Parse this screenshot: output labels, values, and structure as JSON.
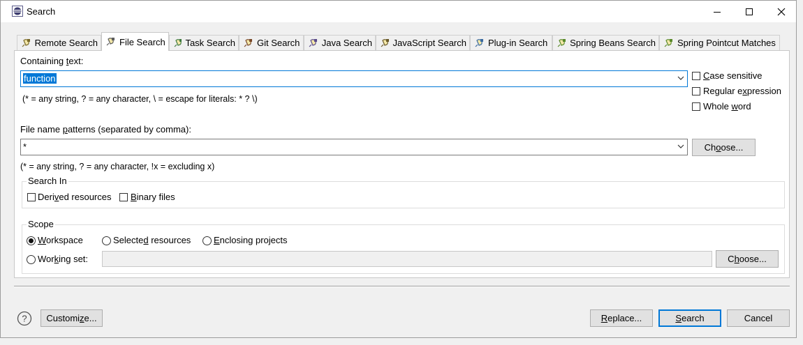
{
  "window": {
    "title": "Search"
  },
  "tabs": [
    {
      "label": "Remote Search",
      "active": false
    },
    {
      "label": "File Search",
      "active": true
    },
    {
      "label": "Task Search",
      "active": false
    },
    {
      "label": "Git Search",
      "active": false
    },
    {
      "label": "Java Search",
      "active": false
    },
    {
      "label": "JavaScript Search",
      "active": false
    },
    {
      "label": "Plug-in Search",
      "active": false
    },
    {
      "label": "Spring Beans Search",
      "active": false
    },
    {
      "label": "Spring Pointcut Matches",
      "active": false
    }
  ],
  "containing": {
    "label_pre": "Containing ",
    "label_ul": "t",
    "label_post": "ext:",
    "value": "function",
    "hint": "(* = any string, ? = any character, \\ = escape for literals: * ? \\)"
  },
  "options": {
    "case_sensitive": {
      "pre": "",
      "ul": "C",
      "post": "ase sensitive",
      "checked": false
    },
    "regex": {
      "pre": "Regular e",
      "ul": "x",
      "post": "pression",
      "checked": false
    },
    "whole_word": {
      "pre": "Whole ",
      "ul": "w",
      "post": "ord",
      "checked": false
    }
  },
  "file_patterns": {
    "label_pre": "File name ",
    "label_ul": "p",
    "label_post": "atterns (separated by comma):",
    "value": "*",
    "hint": "(* = any string, ? = any character, !x = excluding x)",
    "choose_pre": "Ch",
    "choose_ul": "o",
    "choose_post": "ose..."
  },
  "search_in": {
    "legend": "Search In",
    "derived": {
      "pre": "Deri",
      "ul": "v",
      "post": "ed resources",
      "checked": false
    },
    "binary": {
      "pre": "",
      "ul": "B",
      "post": "inary files",
      "checked": false
    }
  },
  "scope": {
    "legend": "Scope",
    "workspace": {
      "pre": "",
      "ul": "W",
      "post": "orkspace",
      "selected": true
    },
    "selected_resources": {
      "pre": "Selecte",
      "ul": "d",
      "post": " resources",
      "selected": false
    },
    "enclosing_projects": {
      "pre": "",
      "ul": "E",
      "post": "nclosing projects",
      "selected": false
    },
    "working_set": {
      "pre": "Wor",
      "ul": "k",
      "post": "ing set:",
      "selected": false,
      "value": ""
    },
    "choose_pre": "C",
    "choose_ul": "h",
    "choose_post": "oose..."
  },
  "footer": {
    "customize_pre": "Customi",
    "customize_ul": "z",
    "customize_post": "e...",
    "replace_pre": "",
    "replace_ul": "R",
    "replace_post": "eplace...",
    "search_pre": "",
    "search_ul": "S",
    "search_post": "earch",
    "cancel": "Cancel"
  },
  "colors": {
    "accent": "#0078d7",
    "panel": "#ffffff",
    "dialog": "#f0f0f0"
  }
}
